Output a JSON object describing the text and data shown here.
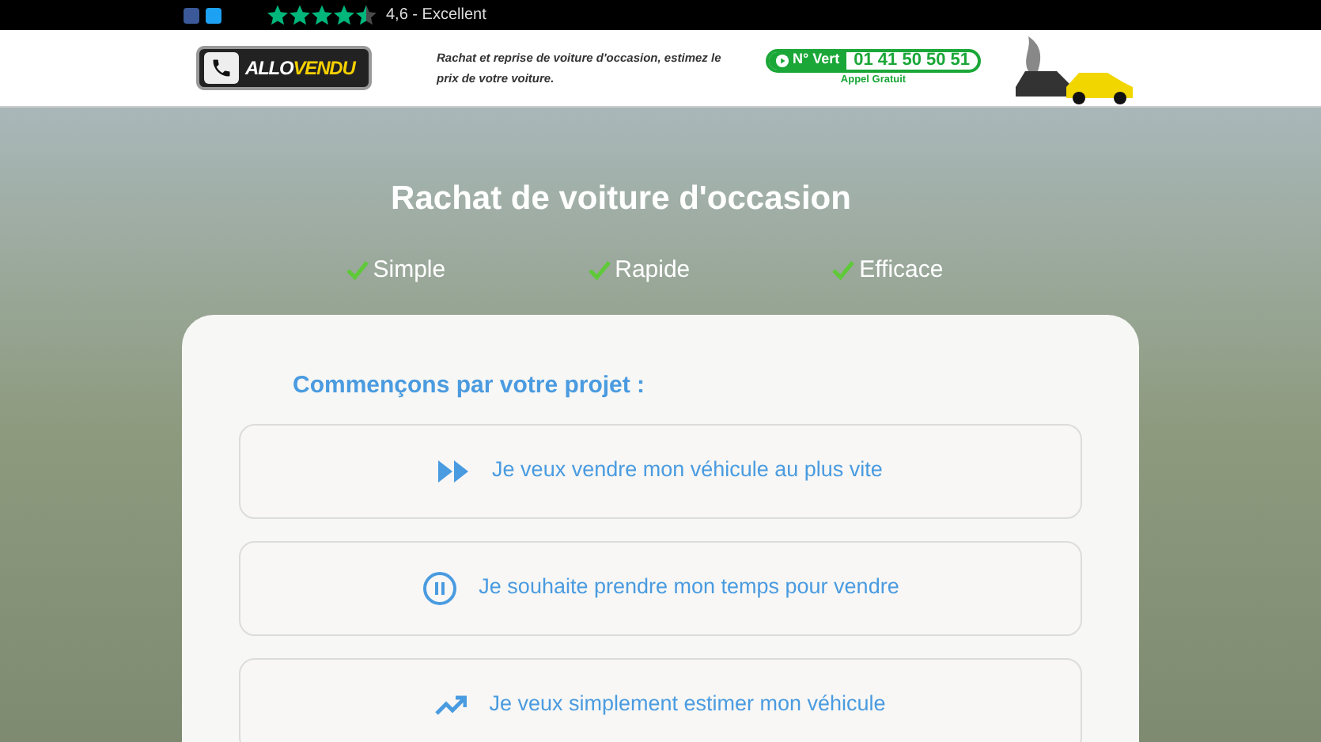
{
  "topbar": {
    "rating": {
      "stars": 4.5,
      "text": "4,6 - Excellent"
    }
  },
  "header": {
    "logo": {
      "part_1": "ALLO",
      "part_2": "VENDU"
    },
    "tagline": "Rachat et reprise de voiture d'occasion, estimez le prix de votre voiture.",
    "phone": {
      "label": "N° Vert",
      "number": "01 41 50 50 51",
      "note": "Appel Gratuit"
    }
  },
  "hero": {
    "title": "Rachat de voiture d'occasion",
    "features": [
      "Simple",
      "Rapide",
      "Efficace"
    ]
  },
  "card": {
    "heading": "Commençons par votre projet :",
    "options": [
      {
        "kind": "fast",
        "label": "Je veux vendre mon véhicule au plus vite"
      },
      {
        "kind": "pause",
        "label": "Je souhaite prendre mon temps pour vendre"
      },
      {
        "kind": "estimate",
        "label": "Je veux simplement estimer mon véhicule"
      }
    ]
  }
}
